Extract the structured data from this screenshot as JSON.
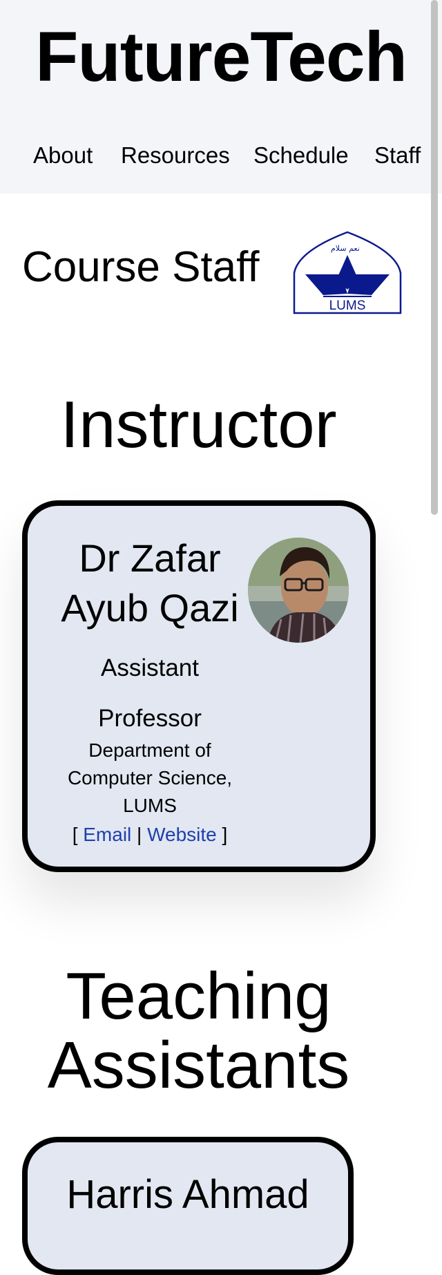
{
  "site": {
    "title": "FutureTech"
  },
  "nav": {
    "items": [
      "About",
      "Resources",
      "Schedule",
      "Staff"
    ]
  },
  "page": {
    "title": "Course Staff"
  },
  "logo": {
    "text": "LUMS",
    "calligraphy": "نعم سلام"
  },
  "instructor_section": {
    "heading": "Instructor",
    "card": {
      "name_line1": "Dr Zafar",
      "name_line2": "Ayub Qazi",
      "title_line1": "Assistant",
      "title_line2": "Professor",
      "dept_line1": "Department of",
      "dept_line2": "Computer Science,",
      "dept_line3": "LUMS",
      "bracket_open": "[",
      "email_label": "Email",
      "separator": "|",
      "website_label": "Website",
      "bracket_close": "]"
    }
  },
  "ta_section": {
    "heading_line1": "Teaching",
    "heading_line2": "Assistants",
    "card": {
      "name": "Harris Ahmad"
    }
  },
  "colors": {
    "header_bg": "#f4f5f9",
    "card_bg": "#e2e7f1",
    "link": "#1e40af",
    "logo_blue": "#0a1a8c"
  }
}
